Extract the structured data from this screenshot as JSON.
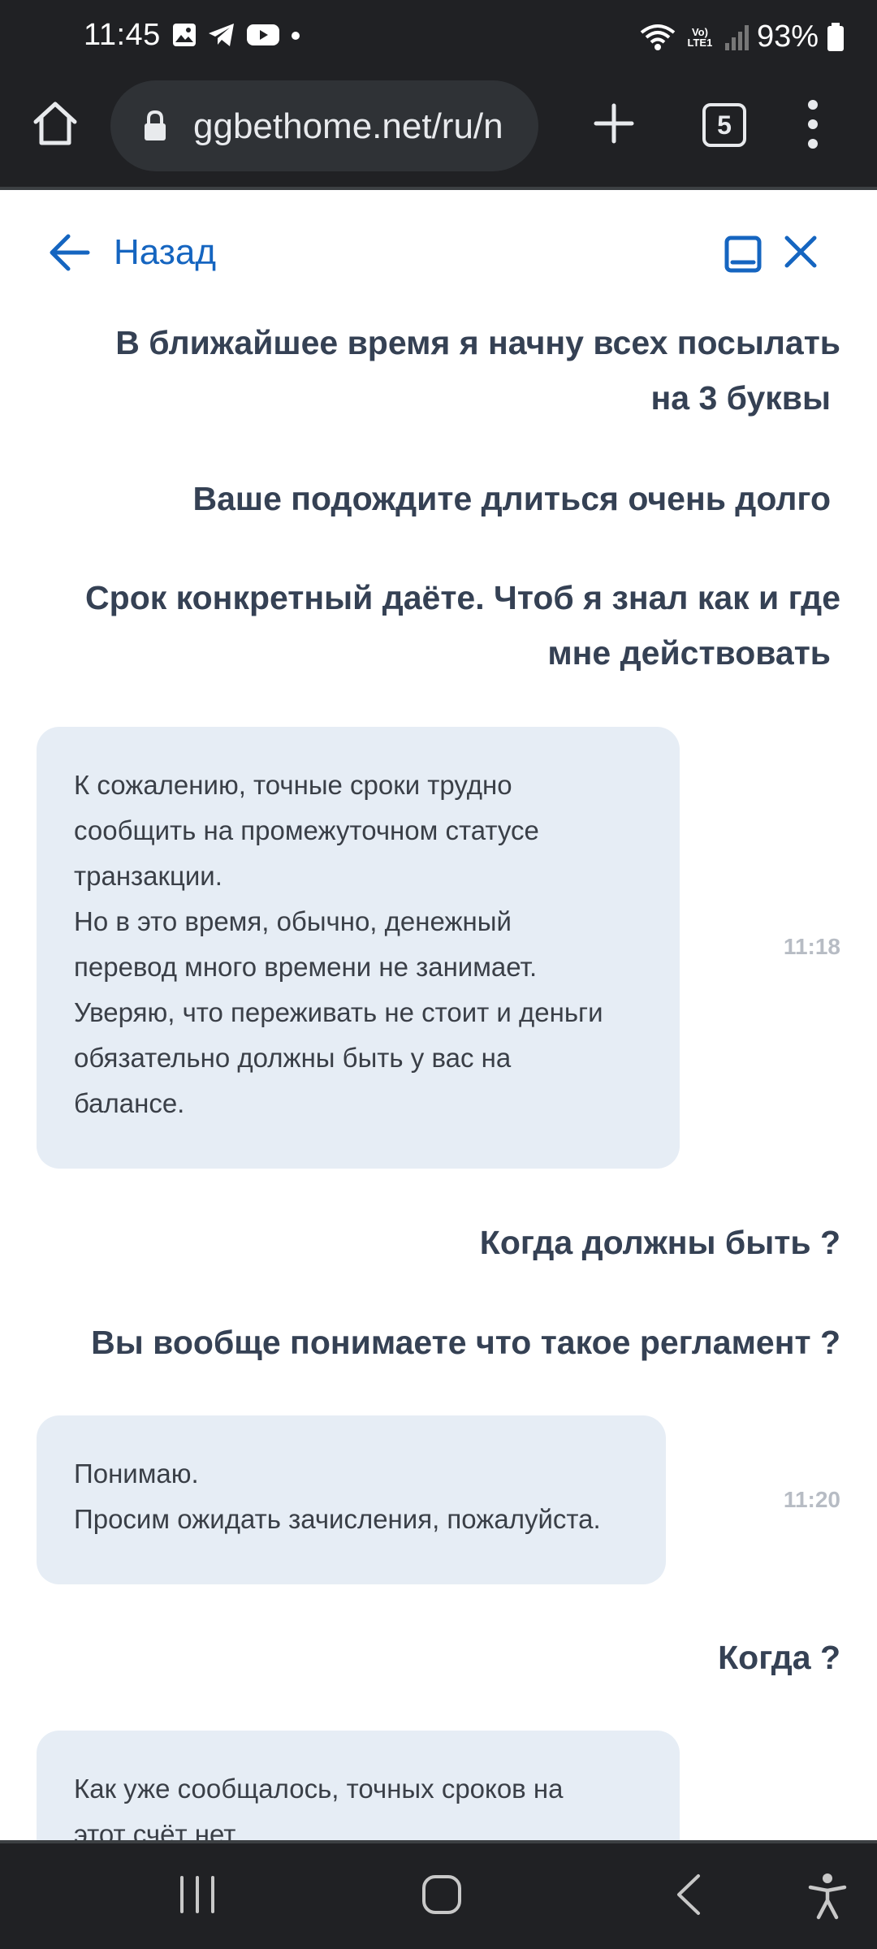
{
  "status_bar": {
    "time": "11:45",
    "network_label": "Vo) LTE1",
    "battery": "93%"
  },
  "browser": {
    "url": "ggbethome.net/ru/n",
    "tab_count": "5"
  },
  "chat_header": {
    "back_label": "Назад"
  },
  "messages": {
    "m1": [
      "В ближайшее время я начну всех посылать",
      "на 3 буквы"
    ],
    "m2": [
      "Ваше подождите длиться очень долго"
    ],
    "m3": [
      "Срок конкретный даёте. Чтоб я знал как и где",
      "мне действовать"
    ],
    "r1": {
      "lines": [
        "К сожалению, точные сроки трудно",
        "сообщить на промежуточном статусе",
        "транзакции.",
        "Но в это время, обычно, денежный",
        "перевод много времени не занимает.",
        "Уверяю, что переживать не стоит и деньги",
        "обязательно должны быть у вас на",
        "балансе."
      ],
      "time": "11:18"
    },
    "m4": [
      "Когда должны быть ?"
    ],
    "m5": [
      "Вы вообще понимаете что такое регламент ?"
    ],
    "r2": {
      "lines": [
        "Понимаю.",
        "Просим ожидать зачисления, пожалуйста."
      ],
      "time": "11:20"
    },
    "m6": [
      "Когда ?"
    ],
    "r3": {
      "lines": [
        "Как уже сообщалось, точных сроков на",
        "этот счёт нет."
      ]
    }
  }
}
